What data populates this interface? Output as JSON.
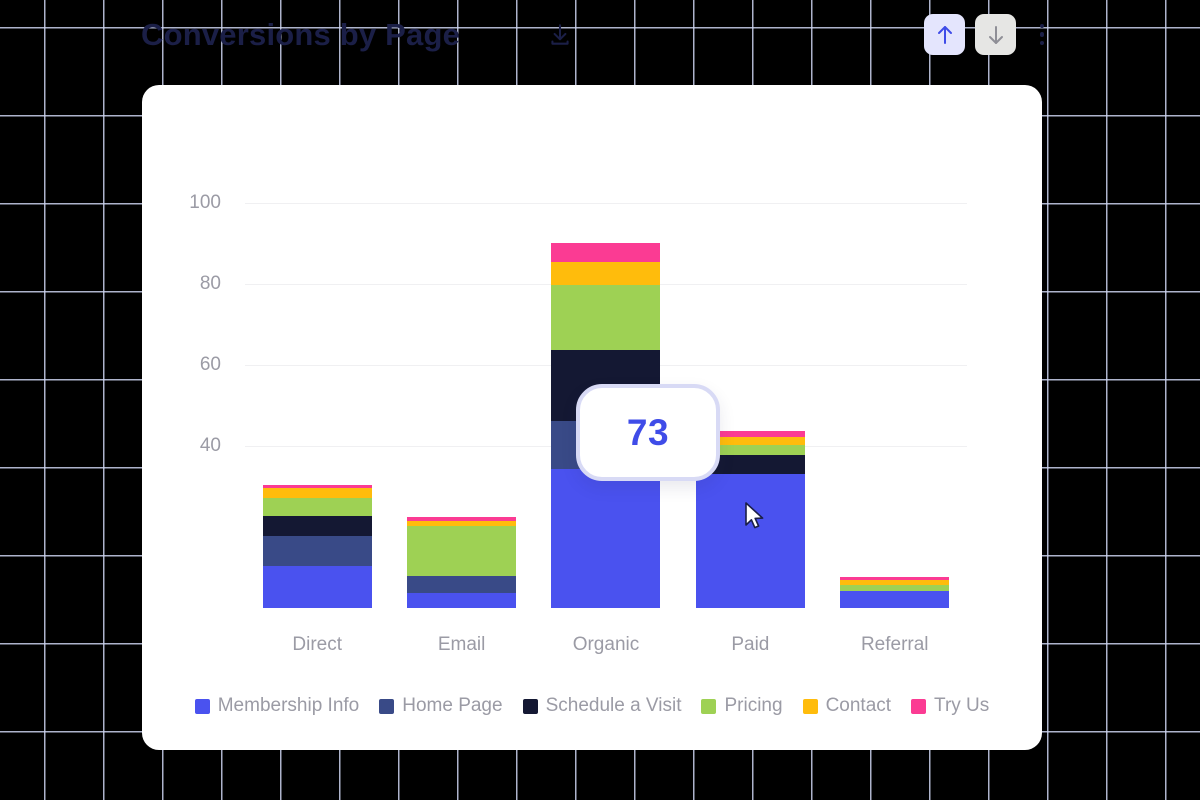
{
  "header": {
    "title": "Conversions by Page",
    "download_icon": "download-icon",
    "sort_asc_label": "sort-ascending",
    "sort_desc_label": "sort-descending",
    "menu_label": "more-options"
  },
  "tooltip": {
    "value": "73"
  },
  "chart_data": {
    "type": "bar",
    "stacked": true,
    "title": "Conversions by Page",
    "xlabel": "",
    "ylabel": "",
    "categories": [
      "Direct",
      "Email",
      "Organic",
      "Paid",
      "Referral"
    ],
    "yticks": [
      100,
      80,
      60,
      40
    ],
    "ylim": [
      0,
      105
    ],
    "grid": "horizontal",
    "legend_position": "bottom",
    "series": [
      {
        "name": "Membership Info",
        "color": "#4a52ef",
        "values": [
          10.5,
          3.8,
          34.3,
          33.2,
          4.2
        ]
      },
      {
        "name": "Home Page",
        "color": "#394a87",
        "values": [
          7.3,
          4.2,
          12.0,
          0.0,
          0.0
        ]
      },
      {
        "name": "Schedule a Visit",
        "color": "#141833",
        "values": [
          4.9,
          0.0,
          17.4,
          4.5,
          0.0
        ]
      },
      {
        "name": "Pricing",
        "color": "#9ed154",
        "values": [
          4.5,
          12.2,
          16.2,
          2.6,
          1.6
        ]
      },
      {
        "name": "Contact",
        "color": "#ffbc0c",
        "values": [
          2.4,
          1.2,
          5.6,
          1.9,
          1.2
        ]
      },
      {
        "name": "Try Us",
        "color": "#fb3b93",
        "values": [
          0.9,
          1.2,
          4.7,
          1.6,
          0.7
        ]
      }
    ],
    "totals": [
      30.5,
      22.6,
      90.2,
      43.8,
      7.7
    ],
    "hovered": {
      "category": "Organic",
      "series": "Home Page",
      "value": 73
    }
  }
}
